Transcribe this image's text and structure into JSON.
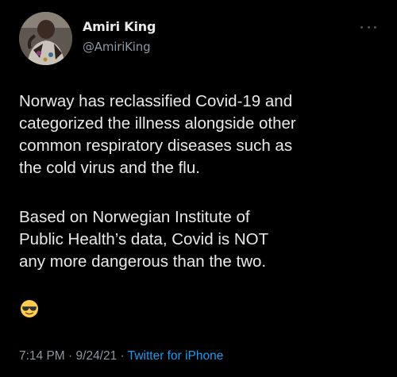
{
  "author": {
    "display_name": "Amiri King",
    "handle": "@AmiriKing",
    "avatar_icon": "profile-photo"
  },
  "tweet": {
    "paragraph_1": "Norway has reclassified Covid-19 and\ncategorized the illness alongside other\ncommon respiratory diseases such as\nthe cold virus and the flu.",
    "paragraph_2": "Based on Norwegian Institute of\nPublic Health’s data, Covid is NOT\nany more dangerous than the two.",
    "emoji": "smiling-face-with-sunglasses"
  },
  "meta": {
    "time": "7:14 PM",
    "separator": " · ",
    "date": "9/24/21",
    "source": "Twitter for iPhone"
  },
  "colors": {
    "background": "#000000",
    "primary_text": "#e7e9ea",
    "secondary_text": "#8b98a5",
    "link": "#1d9bf0"
  }
}
